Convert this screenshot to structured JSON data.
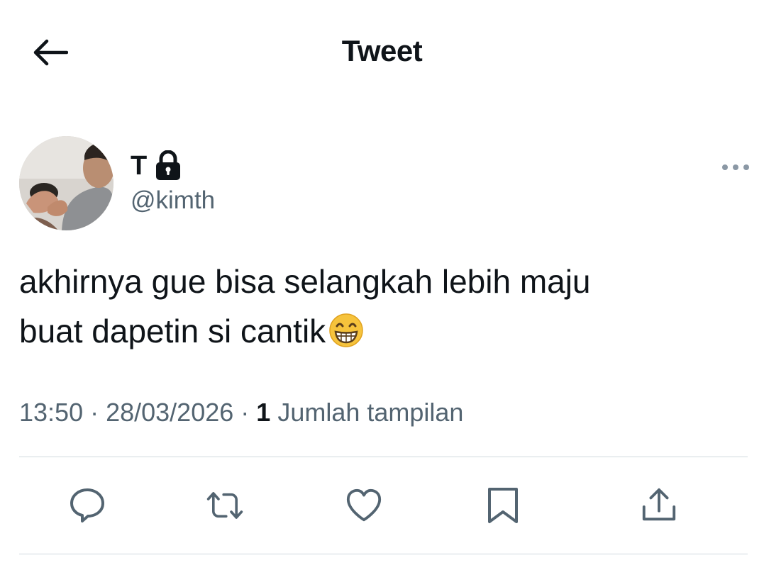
{
  "header": {
    "title": "Tweet"
  },
  "author": {
    "display_name": "T",
    "username": "@kimth",
    "protected": true
  },
  "tweet": {
    "text_line1": "akhirnya gue bisa selangkah lebih maju",
    "text_line2": "buat dapetin si cantik",
    "emoji": "grinning-face-with-smiling-eyes",
    "time": "13:50",
    "date": "28/03/2026",
    "separator": " · ",
    "view_count": "1",
    "view_label": " Jumlah tampilan"
  },
  "actions": [
    "reply-icon",
    "retweet-icon",
    "like-icon",
    "bookmark-icon",
    "share-icon"
  ],
  "colors": {
    "text": "#0f1419",
    "secondary": "#536471",
    "divider": "#cfd9de",
    "emoji": "#f6c33c"
  }
}
